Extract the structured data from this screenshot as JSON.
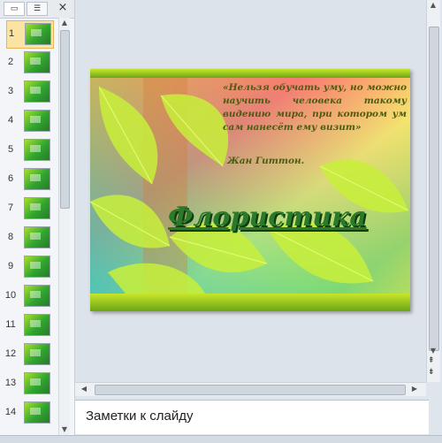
{
  "left_pane": {
    "close_label": "×",
    "thumbnails": [
      {
        "num": "1"
      },
      {
        "num": "2"
      },
      {
        "num": "3"
      },
      {
        "num": "4"
      },
      {
        "num": "5"
      },
      {
        "num": "6"
      },
      {
        "num": "7"
      },
      {
        "num": "8"
      },
      {
        "num": "9"
      },
      {
        "num": "10"
      },
      {
        "num": "11"
      },
      {
        "num": "12"
      },
      {
        "num": "13"
      },
      {
        "num": "14"
      }
    ],
    "selected": 1
  },
  "slide": {
    "quote": "«Нельзя обучать уму, но можно научить человека такому видению мира, при котором ум сам нанесёт ему визит»",
    "author": "Жан Гиттон.",
    "title": "Флористика"
  },
  "notes": {
    "placeholder": "Заметки к слайду"
  },
  "colors": {
    "accent_selected": "#fbe3a4",
    "title_green": "#2b7a2b"
  }
}
